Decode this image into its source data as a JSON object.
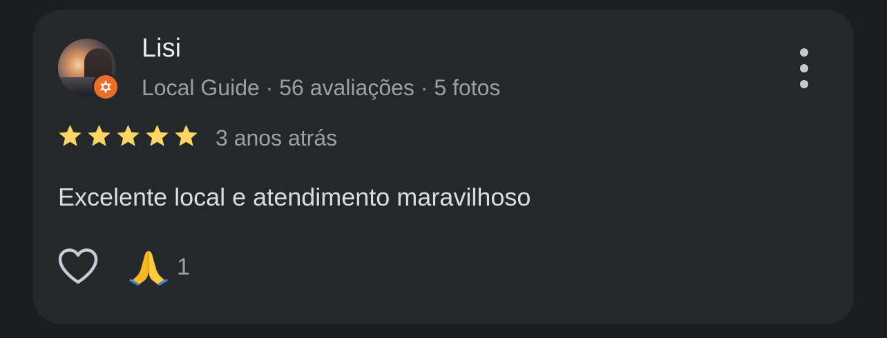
{
  "review": {
    "author_name": "Lisi",
    "author_meta": "Local Guide · 56 avaliações · 5 fotos",
    "rating": 5,
    "rating_max": 5,
    "time_ago": "3 anos atrás",
    "text": "Excelente local e atendimento maravilhoso",
    "reaction_count": "1"
  },
  "icons": {
    "menu": "more-vertical-icon",
    "like": "heart-outline-icon",
    "reaction": "folded-hands-icon",
    "badge": "local-guide-badge-icon",
    "star": "star-icon"
  },
  "colors": {
    "card_background": "#25272a",
    "page_background": "#1b1d20",
    "star": "#fdd663",
    "badge": "#ea6d2b",
    "primary_text": "#e8eaed",
    "secondary_text": "#9aa0a6"
  }
}
